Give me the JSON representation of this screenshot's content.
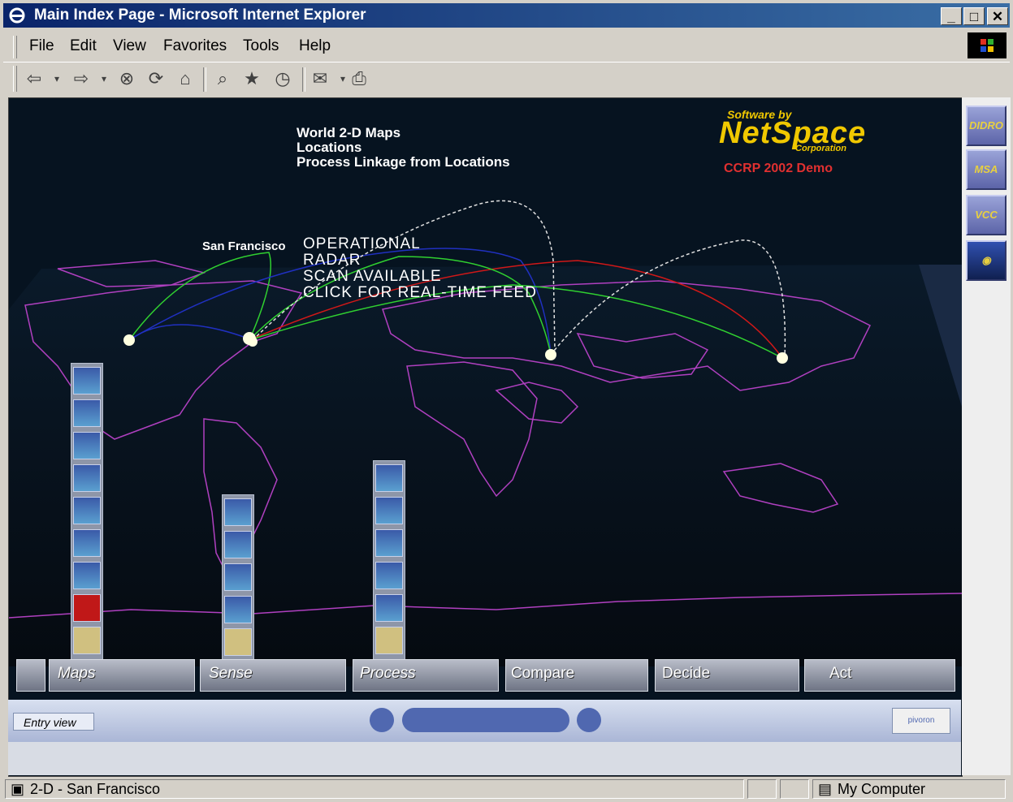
{
  "window": {
    "title": "Main Index Page - Microsoft Internet Explorer"
  },
  "menu": {
    "items": [
      "File",
      "Edit",
      "View",
      "Favorites",
      "Tools",
      "Help"
    ]
  },
  "scene": {
    "header_lines": [
      "World 2-D Maps",
      "Locations",
      "Process Linkage from Locations"
    ],
    "brand_prefix": "Software by",
    "brand_name": "NetSpace",
    "brand_suffix": "Corporation",
    "demo_label": "CCRP 2002 Demo",
    "location_label": "San Francisco",
    "popup_lines": [
      "OPERATIONAL",
      "RADAR",
      "SCAN AVAILABLE",
      "CLICK FOR REAL-TIME FEED"
    ],
    "colors": {
      "map_outline": "#b040c0",
      "link_green": "#30d030",
      "link_blue": "#2030c0",
      "link_red": "#d01818",
      "link_white": "#e0e0e0",
      "brand": "#f0c800",
      "demo": "#e03030"
    }
  },
  "right_panel": {
    "buttons": [
      "DIDRO",
      "MSA",
      "VCC",
      "globe-icon"
    ]
  },
  "controls": {
    "labels": [
      "Maps",
      "Sense",
      "Process",
      "Compare",
      "Decide",
      "Act"
    ]
  },
  "nav": {
    "viewpoint": "Entry view",
    "logo": "pivoron"
  },
  "status": {
    "text": "2-D - San Francisco",
    "zone": "My Computer"
  }
}
